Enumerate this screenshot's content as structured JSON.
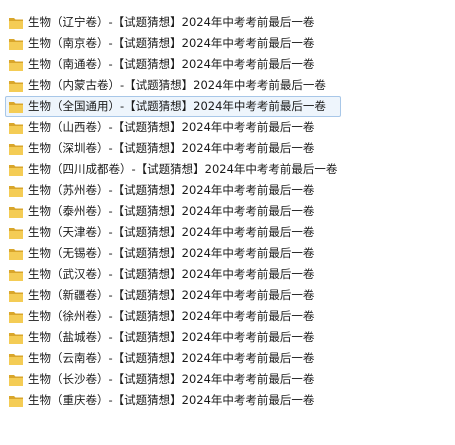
{
  "colors": {
    "folder_back": "#d9a62b",
    "folder_front": "#f4cc55",
    "selection_bg": "#eef5fc",
    "selection_border": "#a8c7e8"
  },
  "items": [
    {
      "label": "生物（辽宁卷）-【试题猜想】2024年中考考前最后一卷",
      "icon": "folder-icon",
      "selected": false
    },
    {
      "label": "生物（南京卷）-【试题猜想】2024年中考考前最后一卷",
      "icon": "folder-icon",
      "selected": false
    },
    {
      "label": "生物（南通卷）-【试题猜想】2024年中考考前最后一卷",
      "icon": "folder-icon",
      "selected": false
    },
    {
      "label": "生物（内蒙古卷）-【试题猜想】2024年中考考前最后一卷",
      "icon": "folder-icon",
      "selected": false
    },
    {
      "label": "生物（全国通用）-【试题猜想】2024年中考考前最后一卷",
      "icon": "folder-icon",
      "selected": true
    },
    {
      "label": "生物（山西卷）-【试题猜想】2024年中考考前最后一卷",
      "icon": "folder-icon",
      "selected": false
    },
    {
      "label": "生物（深圳卷）-【试题猜想】2024年中考考前最后一卷",
      "icon": "folder-icon",
      "selected": false
    },
    {
      "label": "生物（四川成都卷）-【试题猜想】2024年中考考前最后一卷",
      "icon": "folder-icon",
      "selected": false
    },
    {
      "label": "生物（苏州卷）-【试题猜想】2024年中考考前最后一卷",
      "icon": "folder-icon",
      "selected": false
    },
    {
      "label": "生物（泰州卷）-【试题猜想】2024年中考考前最后一卷",
      "icon": "folder-icon",
      "selected": false
    },
    {
      "label": "生物（天津卷）-【试题猜想】2024年中考考前最后一卷",
      "icon": "folder-icon",
      "selected": false
    },
    {
      "label": "生物（无锡卷）-【试题猜想】2024年中考考前最后一卷",
      "icon": "folder-icon",
      "selected": false
    },
    {
      "label": "生物（武汉卷）-【试题猜想】2024年中考考前最后一卷",
      "icon": "folder-icon",
      "selected": false
    },
    {
      "label": "生物（新疆卷）-【试题猜想】2024年中考考前最后一卷",
      "icon": "folder-icon",
      "selected": false
    },
    {
      "label": "生物（徐州卷）-【试题猜想】2024年中考考前最后一卷",
      "icon": "folder-icon",
      "selected": false
    },
    {
      "label": "生物（盐城卷）-【试题猜想】2024年中考考前最后一卷",
      "icon": "folder-icon",
      "selected": false
    },
    {
      "label": "生物（云南卷）-【试题猜想】2024年中考考前最后一卷",
      "icon": "folder-icon",
      "selected": false
    },
    {
      "label": "生物（长沙卷）-【试题猜想】2024年中考考前最后一卷",
      "icon": "folder-icon",
      "selected": false
    },
    {
      "label": "生物（重庆卷）-【试题猜想】2024年中考考前最后一卷",
      "icon": "folder-icon",
      "selected": false
    }
  ]
}
